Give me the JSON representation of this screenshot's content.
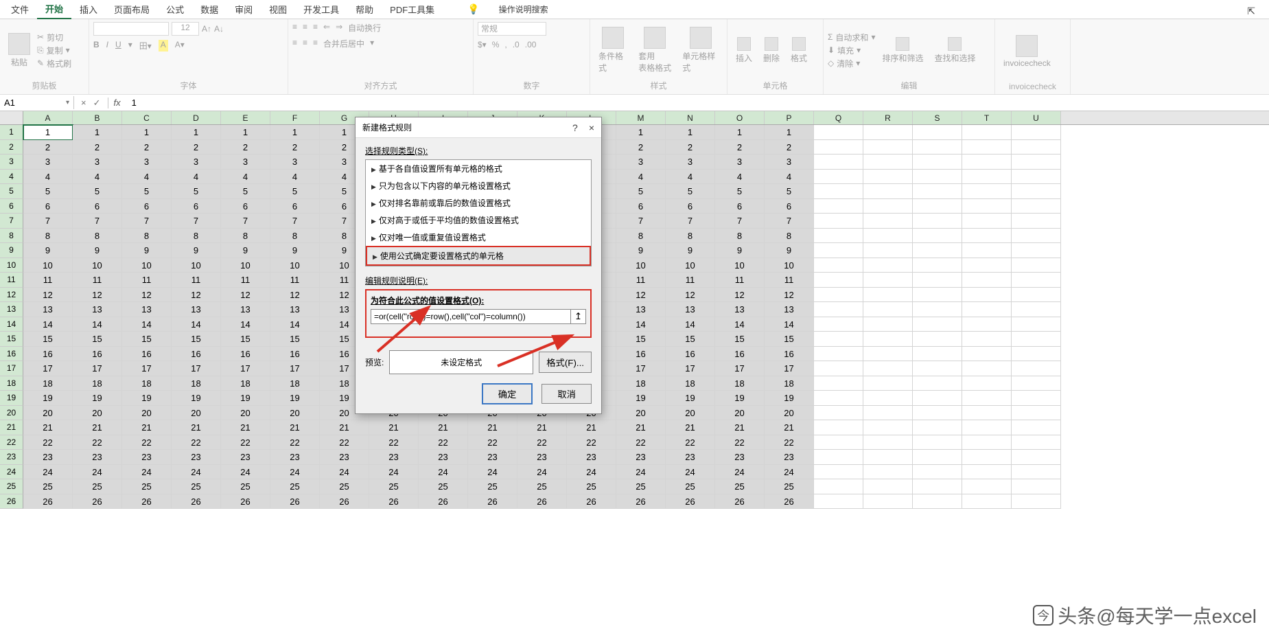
{
  "menubar": {
    "items": [
      "文件",
      "开始",
      "插入",
      "页面布局",
      "公式",
      "数据",
      "审阅",
      "视图",
      "开发工具",
      "帮助",
      "PDF工具集"
    ],
    "active_index": 1,
    "search_hint": "操作说明搜索"
  },
  "ribbon": {
    "clipboard": {
      "paste": "粘贴",
      "cut": "剪切",
      "copy": "复制",
      "painter": "格式刷",
      "label": "剪贴板"
    },
    "font": {
      "label": "字体",
      "size": "12",
      "bold": "B",
      "italic": "I",
      "underline": "U"
    },
    "align": {
      "label": "对齐方式",
      "wrap": "自动换行",
      "merge": "合并后居中"
    },
    "number": {
      "label": "数字",
      "format": "常规"
    },
    "styles": {
      "label": "样式",
      "cond": "条件格式",
      "table": "套用\n表格格式",
      "cell": "单元格样式"
    },
    "cells": {
      "label": "单元格",
      "insert": "插入",
      "delete": "删除",
      "format": "格式"
    },
    "editing": {
      "label": "编辑",
      "sum": "自动求和",
      "fill": "填充",
      "clear": "清除",
      "sort": "排序和筛选",
      "find": "查找和选择"
    },
    "custom": {
      "label": "invoicecheck",
      "btn": "invoicecheck"
    }
  },
  "namebar": {
    "name": "A1",
    "formula": "1"
  },
  "grid": {
    "columns": [
      "A",
      "B",
      "C",
      "D",
      "E",
      "F",
      "G",
      "H",
      "I",
      "J",
      "K",
      "L",
      "M",
      "N",
      "O",
      "P",
      "Q",
      "R",
      "S",
      "T",
      "U"
    ],
    "active_cell": "A1",
    "rows": 26,
    "data_cols": 16
  },
  "dialog": {
    "title": "新建格式规则",
    "help": "?",
    "close": "×",
    "select_type_label": "选择规则类型(S):",
    "rule_types": [
      "基于各自值设置所有单元格的格式",
      "只为包含以下内容的单元格设置格式",
      "仅对排名靠前或靠后的数值设置格式",
      "仅对高于或低于平均值的数值设置格式",
      "仅对唯一值或重复值设置格式",
      "使用公式确定要设置格式的单元格"
    ],
    "selected_rule_index": 5,
    "edit_label": "编辑规则说明(E):",
    "formula_label": "为符合此公式的值设置格式(O):",
    "formula_value": "=or(cell(\"row\")=row(),cell(\"col\")=column())",
    "range_picker": "↥",
    "preview_label": "预览:",
    "preview_text": "未设定格式",
    "format_btn": "格式(F)...",
    "ok": "确定",
    "cancel": "取消"
  },
  "watermark": {
    "text": "头条@每天学一点excel"
  }
}
